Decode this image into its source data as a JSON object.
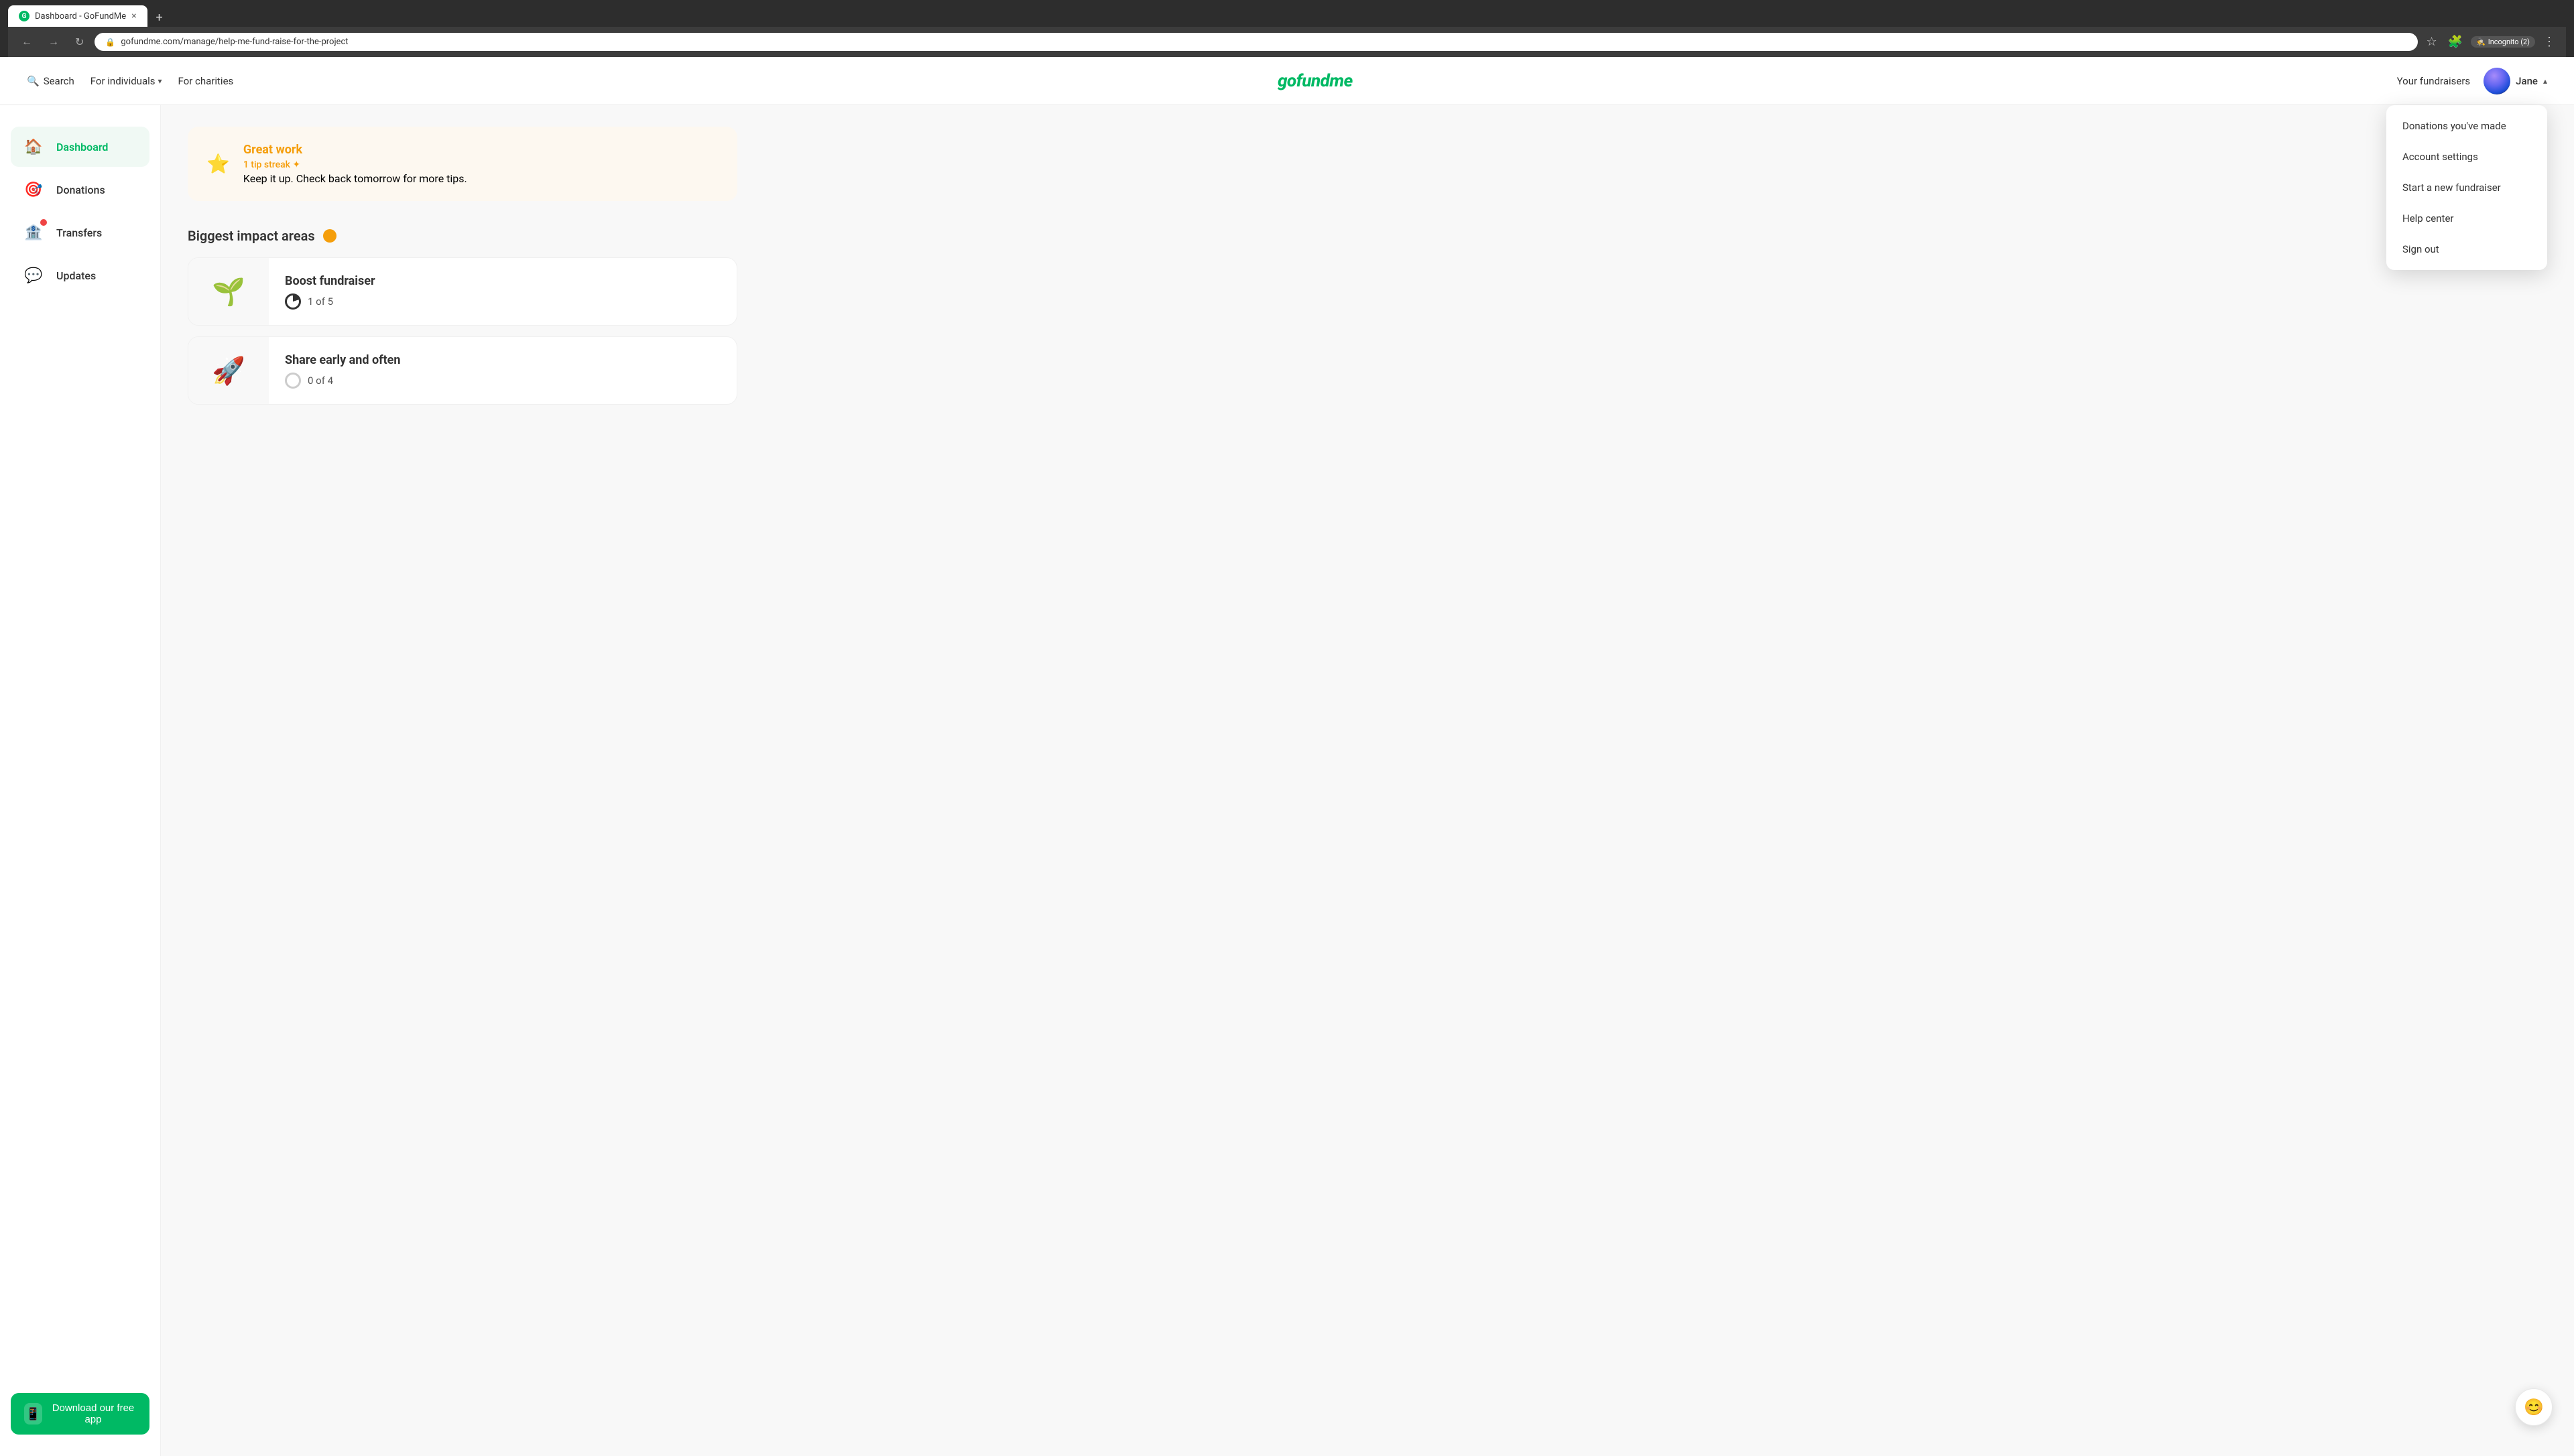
{
  "browser": {
    "tab_title": "Dashboard - GoFundMe",
    "tab_close": "×",
    "tab_new": "+",
    "url": "gofundme.com/manage/help-me-fund-raise-for-the-project",
    "incognito_label": "Incognito (2)",
    "nav_back": "←",
    "nav_forward": "→",
    "nav_refresh": "↻"
  },
  "header": {
    "search_label": "Search",
    "for_individuals_label": "For individuals",
    "for_charities_label": "For charities",
    "logo_text": "gofundme",
    "your_fundraisers_label": "Your fundraisers",
    "username": "Jane"
  },
  "dropdown": {
    "items": [
      {
        "label": "Donations you've made"
      },
      {
        "label": "Account settings"
      },
      {
        "label": "Start a new fundraiser"
      },
      {
        "label": "Help center"
      },
      {
        "label": "Sign out"
      }
    ]
  },
  "sidebar": {
    "items": [
      {
        "id": "dashboard",
        "label": "Dashboard",
        "icon": "🏠",
        "active": true
      },
      {
        "id": "donations",
        "label": "Donations",
        "icon": "🎯",
        "active": false
      },
      {
        "id": "transfers",
        "label": "Transfers",
        "icon": "🏦",
        "active": false,
        "has_notification": true
      },
      {
        "id": "updates",
        "label": "Updates",
        "icon": "💬",
        "active": false
      }
    ],
    "download_app_label": "Download our free app"
  },
  "banner": {
    "title": "Great work",
    "streak": "1 tip streak",
    "streak_icon": "✦",
    "description": "Keep it up. Check back tomorrow for more tips."
  },
  "biggest_impact": {
    "section_title": "Biggest impact areas",
    "cards": [
      {
        "title": "Boost fundraiser",
        "progress": "1 of 5",
        "icon": "🌱",
        "progress_filled": true
      },
      {
        "title": "Share early and often",
        "progress": "0 of 4",
        "icon": "🚀",
        "progress_filled": false
      }
    ]
  },
  "chat_fab_icon": "🙂"
}
